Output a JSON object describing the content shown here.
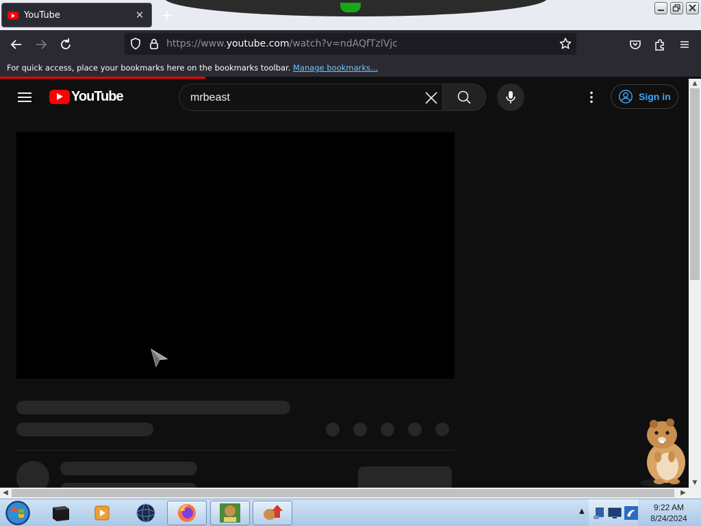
{
  "browser": {
    "tab_title": "YouTube",
    "tab_close": "✕",
    "new_tab": "+",
    "url_scheme": "https://www.",
    "url_host": "youtube.com",
    "url_path": "/watch?v=ndAQfTzlVjc",
    "bookmarks_message": "For quick access, place your bookmarks here on the bookmarks toolbar.",
    "bookmarks_link": "Manage bookmarks...",
    "accent_color": "#ff0000"
  },
  "youtube": {
    "logo_text": "YouTube",
    "search_value": "mrbeast",
    "sign_in_label": "Sign in",
    "brand_red": "#ff0000",
    "link_blue": "#3ea6ff"
  },
  "taskbar": {
    "time": "9:22 AM",
    "date": "8/24/2024",
    "apps": [
      "media-center-icon",
      "media-player-icon",
      "globe-icon",
      "firefox-icon",
      "game-box-icon",
      "game-upload-icon"
    ]
  }
}
